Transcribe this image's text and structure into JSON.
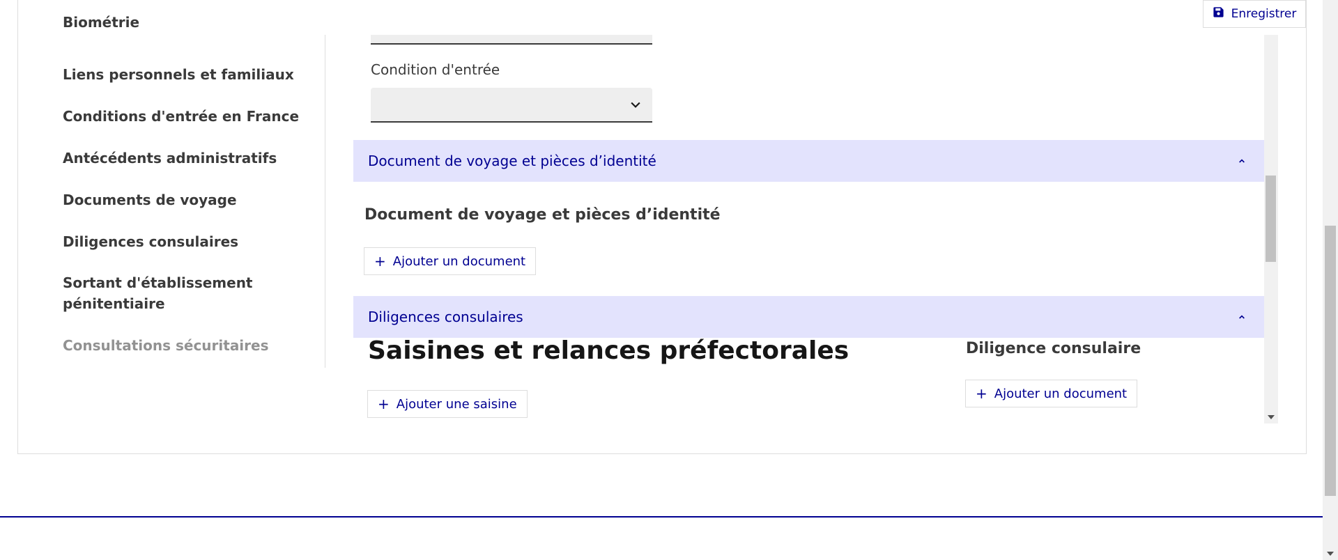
{
  "toolbar": {
    "save_label": "Enregistrer"
  },
  "sidenav": {
    "items": [
      {
        "label": "Biométrie"
      },
      {
        "label": "Liens personnels et familiaux"
      },
      {
        "label": "Conditions d'entrée en France"
      },
      {
        "label": "Antécédents administratifs"
      },
      {
        "label": "Documents de voyage"
      },
      {
        "label": "Diligences consulaires"
      },
      {
        "label": "Sortant d'établissement"
      },
      {
        "label": "pénitentiaire"
      },
      {
        "label": "Consultations sécuritaires"
      }
    ]
  },
  "form": {
    "entry_condition_label": "Condition d'entrée",
    "entry_condition_value": ""
  },
  "accordions": {
    "travel_docs": {
      "header": "Document de voyage et pièces d’identité",
      "section_title": "Document de voyage et pièces d’identité",
      "add_button": "Ajouter un document"
    },
    "consular": {
      "header": "Diligences consulaires",
      "big_title": "Saisines et relances préfectorales",
      "add_referral_button": "Ajouter une saisine",
      "side_title": "Diligence consulaire",
      "add_document_button": "Ajouter un document"
    }
  },
  "icons": {
    "save": "save-icon",
    "select_chevron": "chevron-down-icon",
    "collapse": "chevron-up-icon",
    "add": "plus-icon"
  },
  "colors": {
    "accent": "#000091",
    "accordion_bg": "#e3e3fd",
    "muted_text": "#929292"
  }
}
